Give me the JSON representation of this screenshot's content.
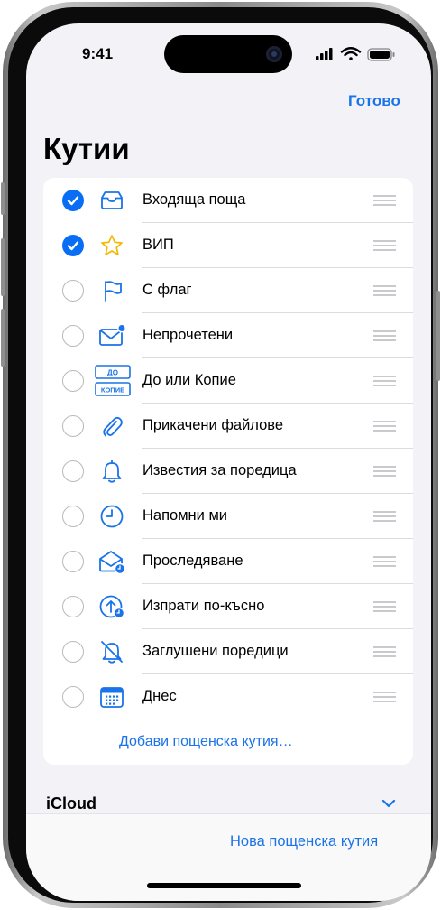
{
  "status": {
    "time": "9:41"
  },
  "nav": {
    "done_label": "Готово",
    "title": "Кутии"
  },
  "mailboxes": [
    {
      "label": "Входяща поща",
      "checked": true,
      "icon": "inbox-tray-icon"
    },
    {
      "label": "ВИП",
      "checked": true,
      "icon": "star-icon"
    },
    {
      "label": "С флаг",
      "checked": false,
      "icon": "flag-icon"
    },
    {
      "label": "Непрочетени",
      "checked": false,
      "icon": "unread-envelope-icon"
    },
    {
      "label": "До или Копие",
      "checked": false,
      "icon": "to-cc-icon"
    },
    {
      "label": "Прикачени файлове",
      "checked": false,
      "icon": "paperclip-icon"
    },
    {
      "label": "Известия за поредица",
      "checked": false,
      "icon": "bell-icon"
    },
    {
      "label": "Напомни ми",
      "checked": false,
      "icon": "clock-icon"
    },
    {
      "label": "Проследяване",
      "checked": false,
      "icon": "envelope-followup-icon"
    },
    {
      "label": "Изпрати по-късно",
      "checked": false,
      "icon": "send-later-icon"
    },
    {
      "label": "Заглушени поредици",
      "checked": false,
      "icon": "bell-slash-icon"
    },
    {
      "label": "Днес",
      "checked": false,
      "icon": "calendar-icon"
    }
  ],
  "icon_text": {
    "to": "ДО",
    "cc": "КОПИЕ"
  },
  "add_mailbox_label": "Добави пощенска кутия…",
  "account": {
    "name": "iCloud"
  },
  "toolbar": {
    "new_mailbox_label": "Нова пощенска кутия"
  },
  "colors": {
    "accent": "#1a73e8",
    "check": "#0a6ef5",
    "background": "#f2f2f7"
  }
}
